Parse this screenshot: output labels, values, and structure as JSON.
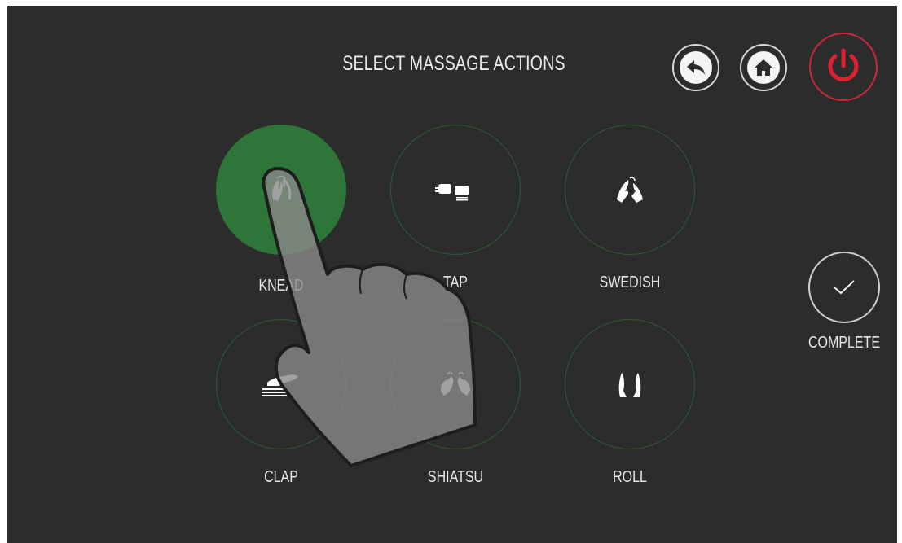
{
  "header": {
    "title": "SELECT MASSAGE ACTIONS"
  },
  "top_buttons": {
    "back_icon": "back-arrow-icon",
    "home_icon": "home-icon",
    "power_icon": "power-icon"
  },
  "actions": [
    {
      "label": "KNEAD",
      "icon": "knead-hands-icon",
      "selected": true
    },
    {
      "label": "TAP",
      "icon": "tap-fists-icon",
      "selected": false
    },
    {
      "label": "SWEDISH",
      "icon": "swedish-hands-icon",
      "selected": false
    },
    {
      "label": "CLAP",
      "icon": "clap-hand-icon",
      "selected": false
    },
    {
      "label": "SHIATSU",
      "icon": "shiatsu-thumbs-icon",
      "selected": false
    },
    {
      "label": "ROLL",
      "icon": "roll-rollers-icon",
      "selected": false
    }
  ],
  "complete": {
    "label": "COMPLETE",
    "icon": "checkmark-icon"
  },
  "colors": {
    "background": "#2c2c2c",
    "selected_fill": "#2e7539",
    "ring": "#2c5d36",
    "power_red": "#e02030"
  }
}
